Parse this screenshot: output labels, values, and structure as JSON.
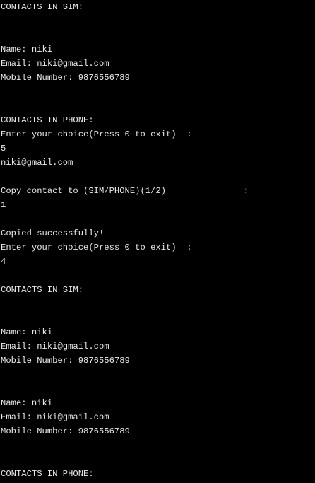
{
  "console": {
    "lines": [
      "CONTACTS IN SIM:",
      "",
      "",
      "Name: niki",
      "Email: niki@gmail.com",
      "Mobile Number: 9876556789",
      "",
      "",
      "CONTACTS IN PHONE:",
      "Enter your choice(Press 0 to exit)  :",
      "5",
      "niki@gmail.com",
      "",
      "Copy contact to (SIM/PHONE)(1/2)               :",
      "1",
      "",
      "Copied successfully!",
      "Enter your choice(Press 0 to exit)  :",
      "4",
      "",
      "CONTACTS IN SIM:",
      "",
      "",
      "Name: niki",
      "Email: niki@gmail.com",
      "Mobile Number: 9876556789",
      "",
      "",
      "Name: niki",
      "Email: niki@gmail.com",
      "Mobile Number: 9876556789",
      "",
      "",
      "CONTACTS IN PHONE:"
    ]
  }
}
